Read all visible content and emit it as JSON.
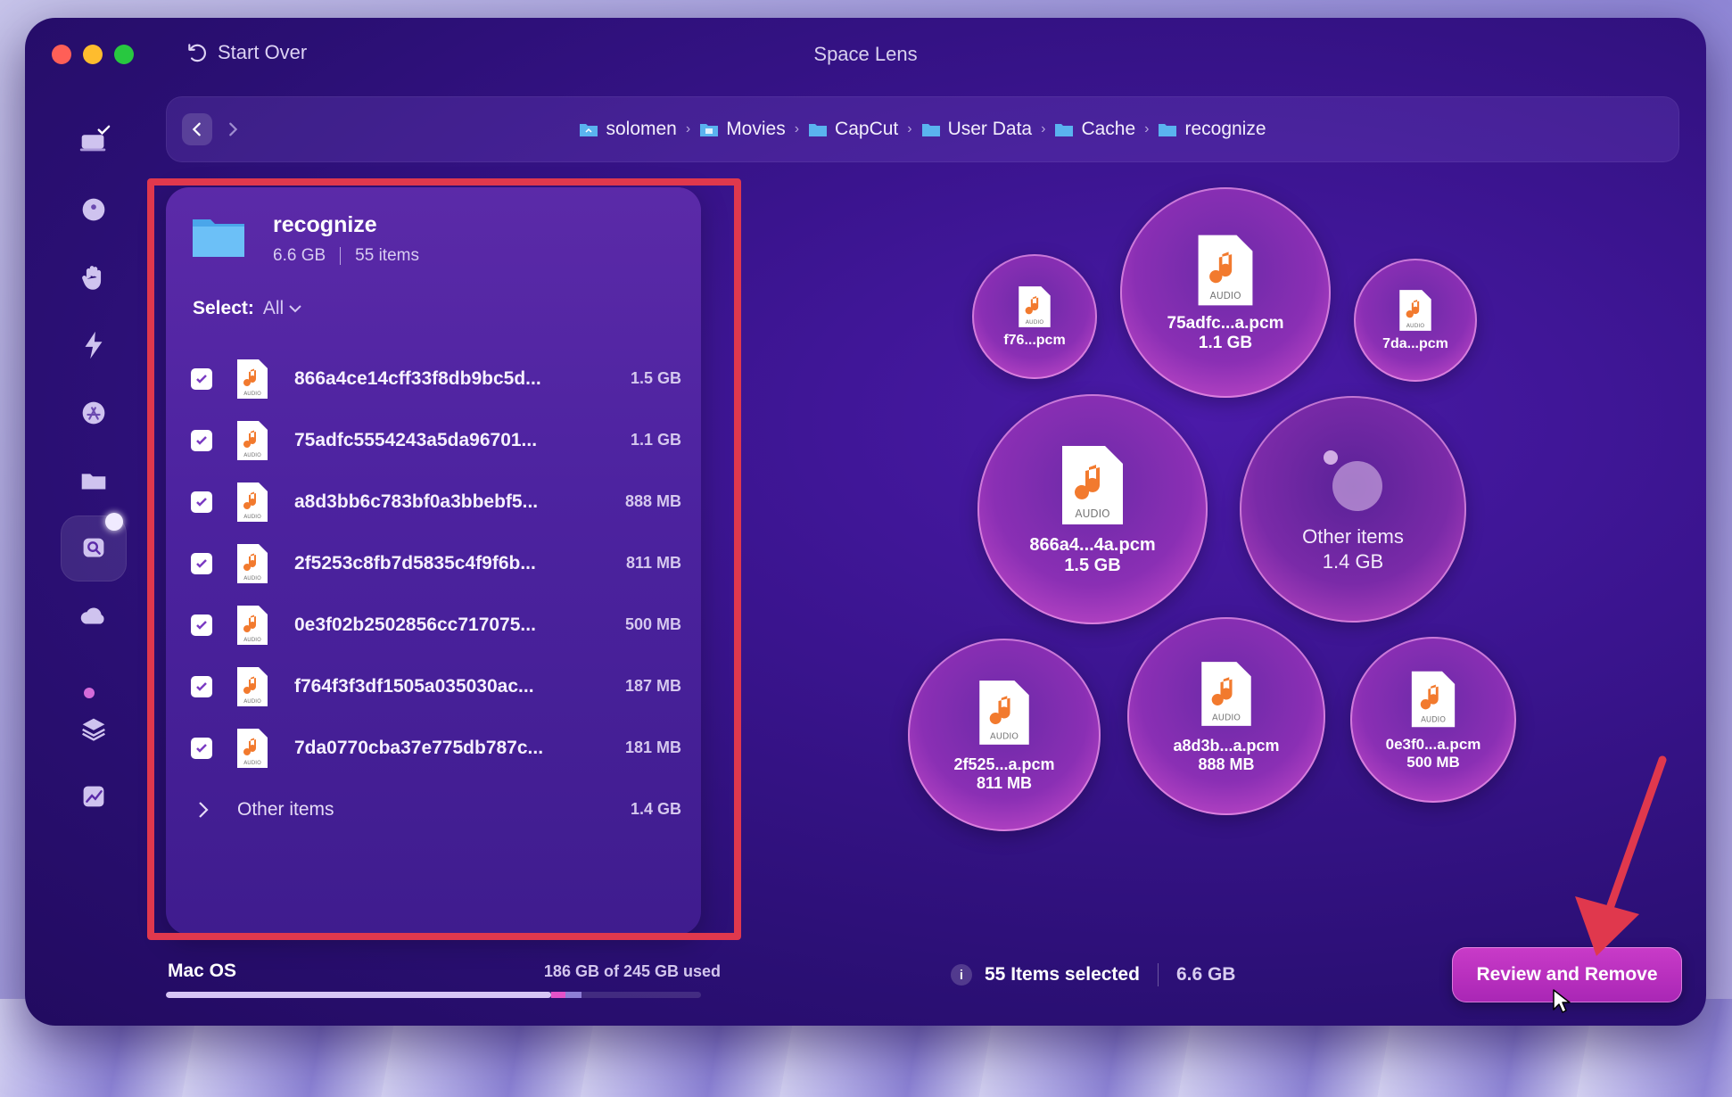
{
  "window": {
    "title": "Space Lens",
    "start_over": "Start Over"
  },
  "breadcrumbs": [
    "solomen",
    "Movies",
    "CapCut",
    "User Data",
    "Cache",
    "recognize"
  ],
  "panel": {
    "title": "recognize",
    "size": "6.6 GB",
    "count": "55 items",
    "select_label": "Select:",
    "select_value": "All",
    "items": [
      {
        "name": "866a4ce14cff33f8db9bc5d...",
        "size": "1.5 GB"
      },
      {
        "name": "75adfc5554243a5da96701...",
        "size": "1.1 GB"
      },
      {
        "name": "a8d3bb6c783bf0a3bbebf5...",
        "size": "888 MB"
      },
      {
        "name": "2f5253c8fb7d5835c4f9f6b...",
        "size": "811 MB"
      },
      {
        "name": "0e3f02b2502856cc717075...",
        "size": "500 MB"
      },
      {
        "name": "f764f3f3df1505a035030ac...",
        "size": "187 MB"
      },
      {
        "name": "7da0770cba37e775db787c...",
        "size": "181 MB"
      }
    ],
    "other": {
      "name": "Other items",
      "size": "1.4 GB"
    }
  },
  "disk": {
    "name": "Mac OS",
    "used_text": "186 GB of 245 GB used",
    "used_fraction": 0.76
  },
  "bubbles": [
    {
      "name": "f76...pcm",
      "size": ""
    },
    {
      "name": "75adfc...a.pcm",
      "size": "1.1 GB"
    },
    {
      "name": "7da...pcm",
      "size": ""
    },
    {
      "name": "866a4...4a.pcm",
      "size": "1.5 GB"
    },
    {
      "name": "Other items",
      "size": "1.4 GB"
    },
    {
      "name": "2f525...a.pcm",
      "size": "811 MB"
    },
    {
      "name": "a8d3b...a.pcm",
      "size": "888 MB"
    },
    {
      "name": "0e3f0...a.pcm",
      "size": "500 MB"
    }
  ],
  "status": {
    "selected": "55 Items selected",
    "total": "6.6 GB",
    "info": "i"
  },
  "review_button": "Review and Remove",
  "file_badge": "AUDIO",
  "colors": {
    "accent": "#c93bc8",
    "highlight_frame": "#e0384d",
    "window_bg": "#3a148e"
  }
}
